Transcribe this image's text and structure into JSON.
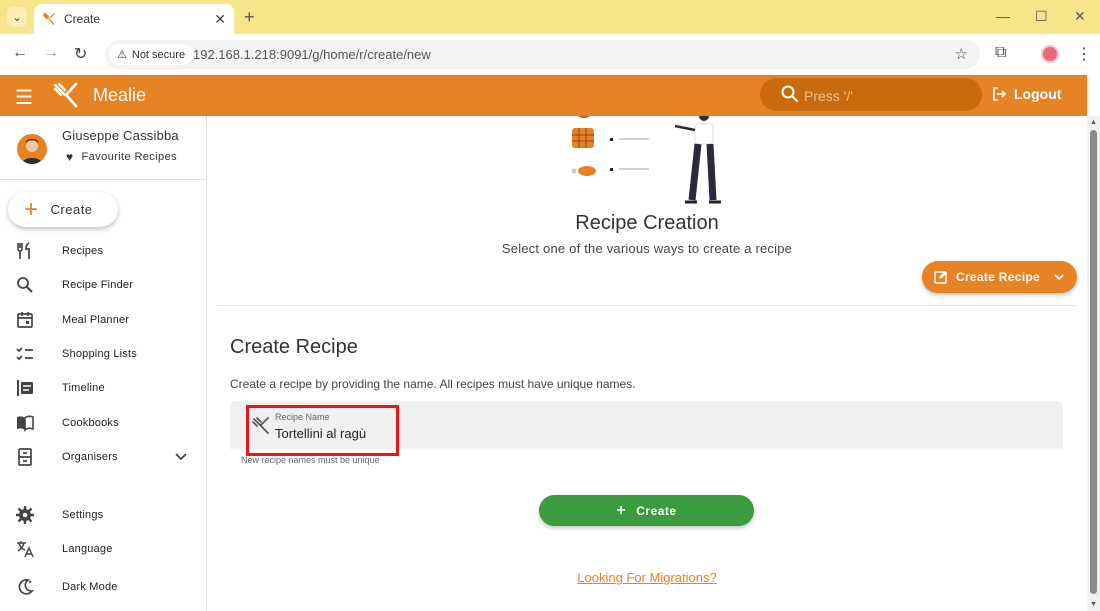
{
  "browser": {
    "tab_title": "Create",
    "security_label": "Not secure",
    "url": "192.168.1.218:9091/g/home/r/create/new"
  },
  "header": {
    "brand": "Mealie",
    "search_placeholder": "Press '/'",
    "logout_label": "Logout",
    "accent_color": "#e58325"
  },
  "sidebar": {
    "user_name": "Giuseppe Cassibba",
    "favourites_label": "Favourite Recipes",
    "create_label": "Create",
    "items": [
      {
        "label": "Recipes",
        "icon": "fork-knife-icon"
      },
      {
        "label": "Recipe Finder",
        "icon": "search-icon"
      },
      {
        "label": "Meal Planner",
        "icon": "calendar-icon"
      },
      {
        "label": "Shopping Lists",
        "icon": "checklist-icon"
      },
      {
        "label": "Timeline",
        "icon": "timeline-icon"
      },
      {
        "label": "Cookbooks",
        "icon": "book-icon"
      },
      {
        "label": "Organisers",
        "icon": "file-cabinet-icon"
      }
    ],
    "bottom_items": [
      {
        "label": "Settings",
        "icon": "gear-icon"
      },
      {
        "label": "Language",
        "icon": "translate-icon"
      },
      {
        "label": "Dark Mode",
        "icon": "moon-icon"
      }
    ]
  },
  "main": {
    "hero_title": "Recipe Creation",
    "hero_subtitle": "Select one of the various ways to create a recipe",
    "create_recipe_button": "Create Recipe",
    "section_title": "Create Recipe",
    "section_description": "Create a recipe by providing the name. All recipes must have unique names.",
    "field_label": "Recipe Name",
    "field_value": "Tortellini al ragù",
    "field_hint": "New recipe names must be unique",
    "create_button": "Create",
    "migrations_link": "Looking For Migrations?",
    "success_color": "#3b9b3f"
  }
}
